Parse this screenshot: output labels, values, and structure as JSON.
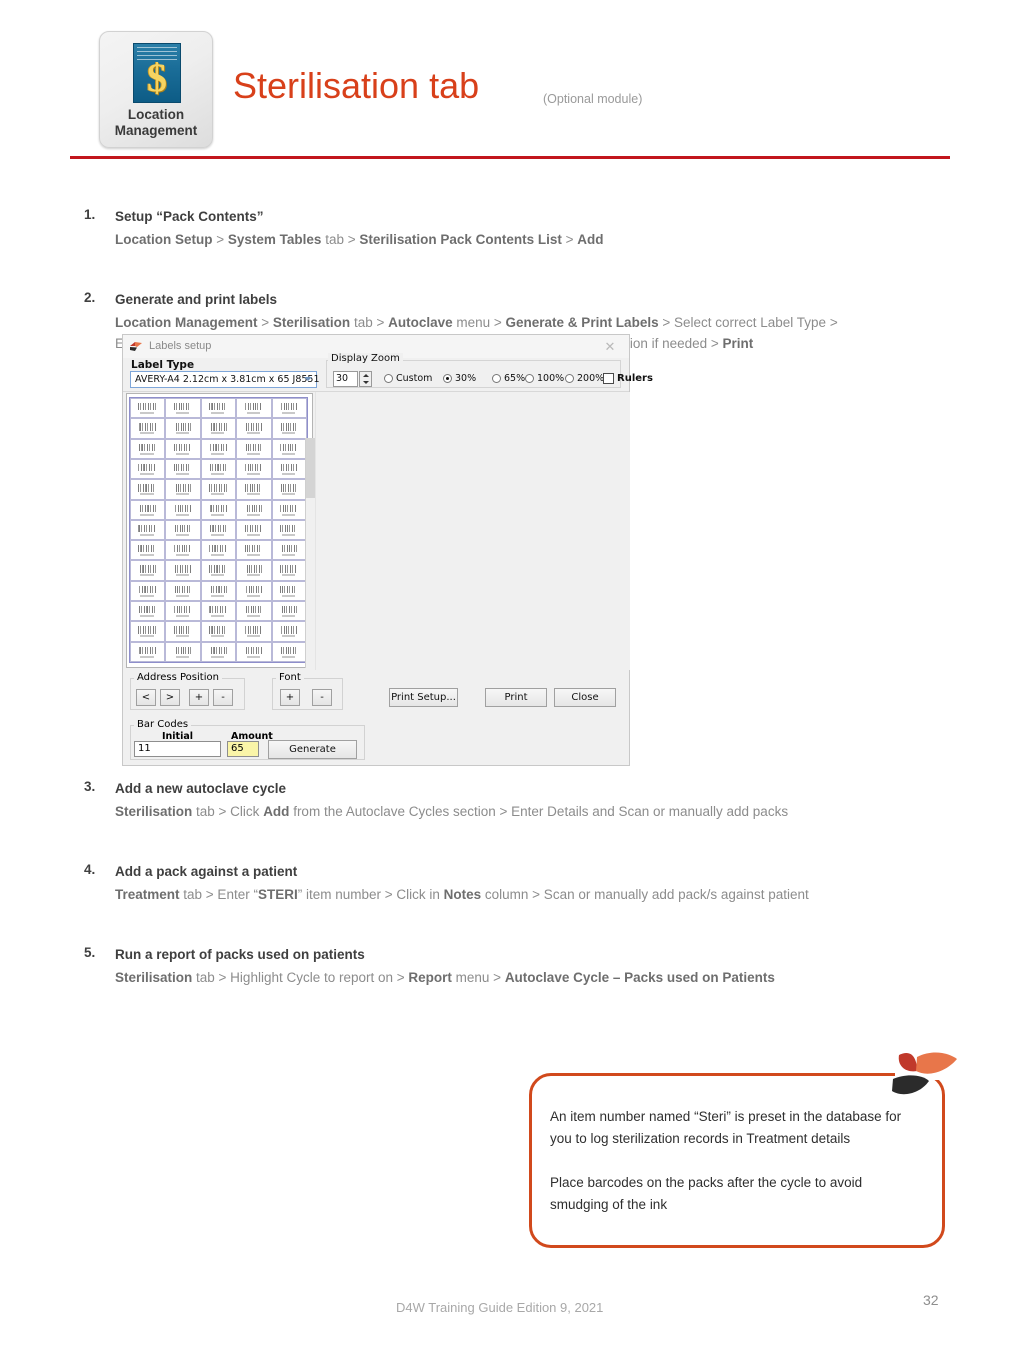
{
  "header": {
    "badge_icon": "location-management-money-document-icon",
    "badge_label_line1": "Location",
    "badge_label_line2": "Management",
    "title": "Sterilisation tab",
    "subtitle": "(Optional module)",
    "rule_color": "#c2161c",
    "title_color": "#d8401a"
  },
  "steps": [
    {
      "num": "1.",
      "title": "Setup “Pack Contents”",
      "path_html": "<b>Location Setup</b> &gt; <b>System Tables</b> tab &gt; <b>Sterilisation Pack Contents List</b> &gt; <b>Add</b>"
    },
    {
      "num": "2.",
      "title": "Generate and print labels",
      "path_html": "<b>Location Management</b> &gt; <b>Sterilisation</b> tab &gt; <b>Autoclave</b> menu &gt; <b>Generate &amp; Print Labels</b> &gt; Select correct Label Type &gt;<br>Enter amount of labels to be printed per page &gt; Click <b>Generate</b> &gt; Adjust barcode position if needed &gt; <b>Print</b>"
    },
    {
      "num": "3.",
      "title": "Add a new autoclave cycle",
      "path_html": "<b>Sterilisation</b> tab &gt; Click <b>Add</b> from the Autoclave Cycles section &gt; Enter Details and Scan or manually add packs"
    },
    {
      "num": "4.",
      "title": "Add a pack against a patient",
      "path_html": "<b>Treatment</b> tab &gt; Enter “<b>STERI</b>” item number &gt; Click in <b>Notes</b> column &gt; Scan or manually add pack/s against patient"
    },
    {
      "num": "5.",
      "title": "Run a report of packs used on patients",
      "path_html": "<b>Sterilisation</b> tab &gt; Highlight Cycle to report on &gt; <b>Report</b> menu &gt; <b>Autoclave Cycle – Packs used on Patients</b>"
    }
  ],
  "labels_dialog": {
    "title": "Labels setup",
    "title_icon": "app-flame-logo-icon",
    "close_icon": "close-icon",
    "label_type_caption": "Label Type",
    "label_type_value": "AVERY-A4 2.12cm x 3.81cm x 65 J8551",
    "label_type_arrow_icon": "chevron-down-icon",
    "display_zoom_caption": "Display Zoom",
    "zoom_value": "30",
    "zoom_options": [
      {
        "label": "Custom",
        "selected": false
      },
      {
        "label": "30%",
        "selected": true
      },
      {
        "label": "65%",
        "selected": false
      },
      {
        "label": "100%",
        "selected": false
      },
      {
        "label": "200%",
        "selected": false
      }
    ],
    "rulers_label": "Rulers",
    "rulers_checked": false,
    "preview": {
      "columns": 5,
      "rows": 13,
      "total_labels": 65
    },
    "address_position_caption": "Address Position",
    "address_position_buttons": [
      "<",
      ">",
      "+",
      "-"
    ],
    "font_caption": "Font",
    "font_buttons": [
      "+",
      "-"
    ],
    "bar_codes_caption": "Bar Codes",
    "initial_caption": "Initial",
    "initial_value": "11",
    "amount_caption": "Amount",
    "amount_value": "65",
    "amount_highlight_color": "#faf5a8",
    "generate_label": "Generate",
    "print_setup_label": "Print Setup...",
    "print_label": "Print",
    "close_label": "Close"
  },
  "callout": {
    "paragraph1": "An item number named “Steri” is preset in the database for you to log sterilization records in Treatment details",
    "paragraph2": "Place barcodes on the packs after the cycle to avoid smudging of the ink",
    "border_color": "#d1491c",
    "logo_icon": "three-leaf-flame-logo-icon",
    "logo_colors": [
      "#c0392b",
      "#e8764a",
      "#2b2b2b"
    ]
  },
  "footer": {
    "text": "D4W Training Guide Edition 9, 2021",
    "page_number": "32"
  }
}
